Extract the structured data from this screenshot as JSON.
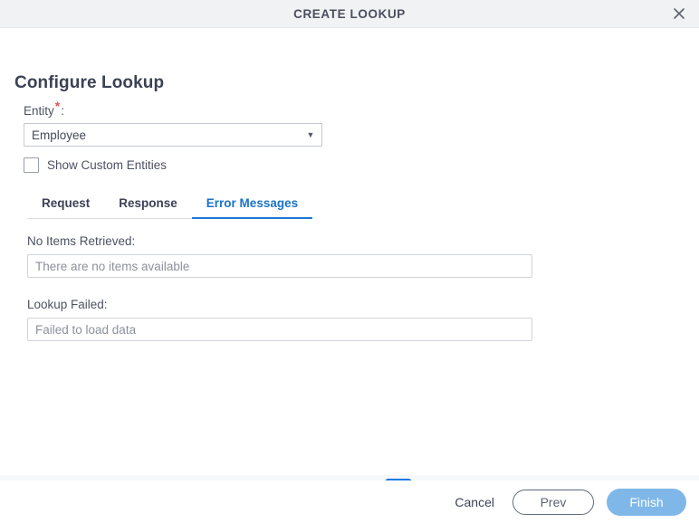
{
  "window": {
    "title": "CREATE LOOKUP",
    "close_icon": "close-icon"
  },
  "page": {
    "heading": "Configure Lookup"
  },
  "entity": {
    "label": "Entity",
    "required_marker": "*",
    "colon": ":",
    "selected_value": "Employee",
    "dropdown_icon": "chevron-down-icon"
  },
  "custom_entities": {
    "label": "Show Custom Entities",
    "checked": false
  },
  "tabs": [
    {
      "label": "Request",
      "active": false
    },
    {
      "label": "Response",
      "active": false
    },
    {
      "label": "Error Messages",
      "active": true
    }
  ],
  "error_messages": {
    "no_items": {
      "label": "No Items Retrieved:",
      "value": "There are no items available",
      "placeholder": "There are no items available"
    },
    "lookup_failed": {
      "label": "Lookup Failed:",
      "value": "Failed to load data",
      "placeholder": "Failed to load data"
    }
  },
  "toolbar": [
    {
      "name": "database-icon",
      "active": false
    },
    {
      "name": "search-settings-icon",
      "active": false
    },
    {
      "name": "search-list-icon",
      "active": false
    },
    {
      "name": "database-settings-icon",
      "active": true
    }
  ],
  "footer": {
    "cancel_label": "Cancel",
    "prev_label": "Prev",
    "finish_label": "Finish"
  },
  "colors": {
    "titlebar_bg": "#f1f2f4",
    "title_text": "#4a4f5e",
    "accent_blue": "#1a7ad4",
    "required_red": "#e8524f",
    "toolbar_strip_bg": "#f7f8fa",
    "toolbar_active_bg": "#1879e0",
    "icon_purple": "#7c3fd6",
    "icon_gray": "#5c6270",
    "finish_bg": "#7fb8e8",
    "input_text": "#8c919c"
  }
}
